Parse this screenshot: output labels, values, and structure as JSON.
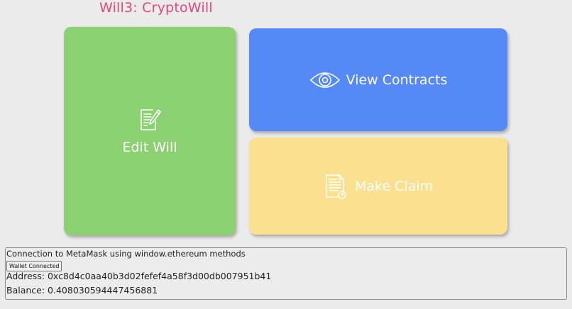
{
  "app": {
    "title": "Will3: CryptoWill"
  },
  "tiles": {
    "edit": {
      "label": "Edit Will",
      "icon": "document-edit-icon",
      "color": "#8bd172"
    },
    "view": {
      "label": "View Contracts",
      "icon": "eye-icon",
      "color": "#5589f5"
    },
    "claim": {
      "label": "Make Claim",
      "icon": "document-clock-icon",
      "color": "#fae08f"
    }
  },
  "wallet": {
    "heading": "Connection to MetaMask using window.ethereum methods",
    "button_label": "Wallet Connected",
    "address_label": "Address: ",
    "address_value": "0xc8d4c0aa40b3d02fefef4a58f3d00db007951b41",
    "balance_label": "Balance: ",
    "balance_value": "0.408030594447456881"
  },
  "colors": {
    "title": "#e04a7a",
    "background": "#ebebeb"
  }
}
